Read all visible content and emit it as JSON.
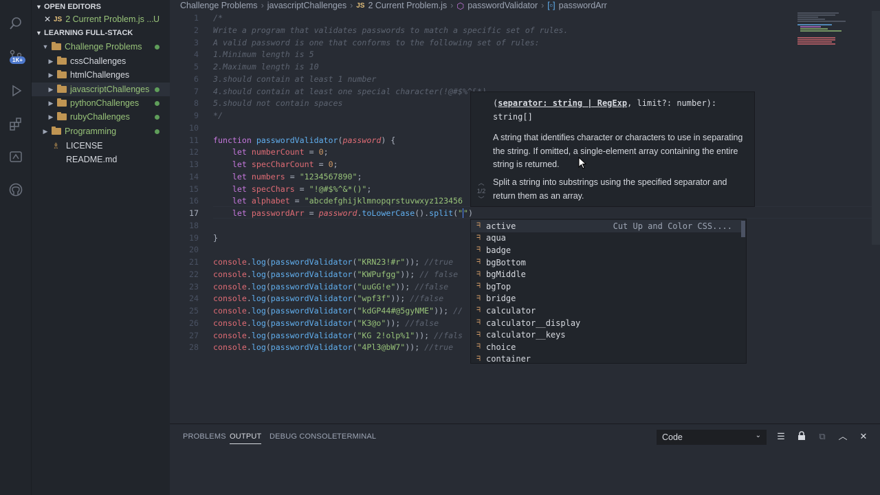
{
  "activity_bar": {
    "badge": "1K+",
    "icons": [
      "search-icon",
      "source-control-icon",
      "run-debug-icon",
      "extensions-icon",
      "remote-icon",
      "github-icon"
    ]
  },
  "sidebar": {
    "open_editors_title": "OPEN EDITORS",
    "open_editor_file": {
      "tag": "JS",
      "name": "2 Current Problem.js ...",
      "status": "U"
    },
    "workspace_title": "LEARNING FULL-STACK",
    "tree": [
      {
        "label": "Challenge Problems",
        "type": "folder",
        "expanded": true,
        "modified": true
      },
      {
        "label": "cssChallenges",
        "type": "folder"
      },
      {
        "label": "htmlChallenges",
        "type": "folder"
      },
      {
        "label": "javascriptChallenges",
        "type": "folder",
        "modified": true
      },
      {
        "label": "pythonChallenges",
        "type": "folder",
        "modified": true
      },
      {
        "label": "rubyChallenges",
        "type": "folder",
        "modified": true
      },
      {
        "label": "Programming",
        "type": "folder",
        "modified": true
      },
      {
        "label": "LICENSE",
        "type": "file"
      },
      {
        "label": "README.md",
        "type": "file"
      }
    ]
  },
  "breadcrumbs": [
    "Challenge Problems",
    "javascriptChallenges",
    "2 Current Problem.js",
    "passwordValidator",
    "passwordArr"
  ],
  "breadcrumb_js_tag": "JS",
  "editor": {
    "line_numbers": [
      "1",
      "2",
      "3",
      "4",
      "5",
      "6",
      "7",
      "8",
      "9",
      "10",
      "11",
      "12",
      "13",
      "14",
      "15",
      "16",
      "17",
      "18",
      "19",
      "20",
      "21",
      "22",
      "23",
      "24",
      "25",
      "26",
      "27",
      "28"
    ]
  },
  "hover": {
    "signature_params": "separator: string | RegExp",
    "signature_rest": ", limit?: number):",
    "signature_return": "string[]",
    "param_doc": "A string that identifies character or characters to use in separating the string. If omitted, a single-element array containing the entire string is returned.",
    "method_doc": "Split a string into substrings using the specified separator and return them as an array.",
    "pager": "1/2"
  },
  "suggestions": {
    "items": [
      "active",
      "aqua",
      "badge",
      "bgBottom",
      "bgMiddle",
      "bgTop",
      "bridge",
      "calculator",
      "calculator__display",
      "calculator__keys",
      "choice",
      "container"
    ],
    "first_detail": "Cut Up and Color CSS...."
  },
  "panel": {
    "tabs": [
      "PROBLEMS",
      "OUTPUT",
      "DEBUG CONSOLE",
      "TERMINAL"
    ],
    "active_tab": "OUTPUT",
    "output_channel": "Code"
  }
}
